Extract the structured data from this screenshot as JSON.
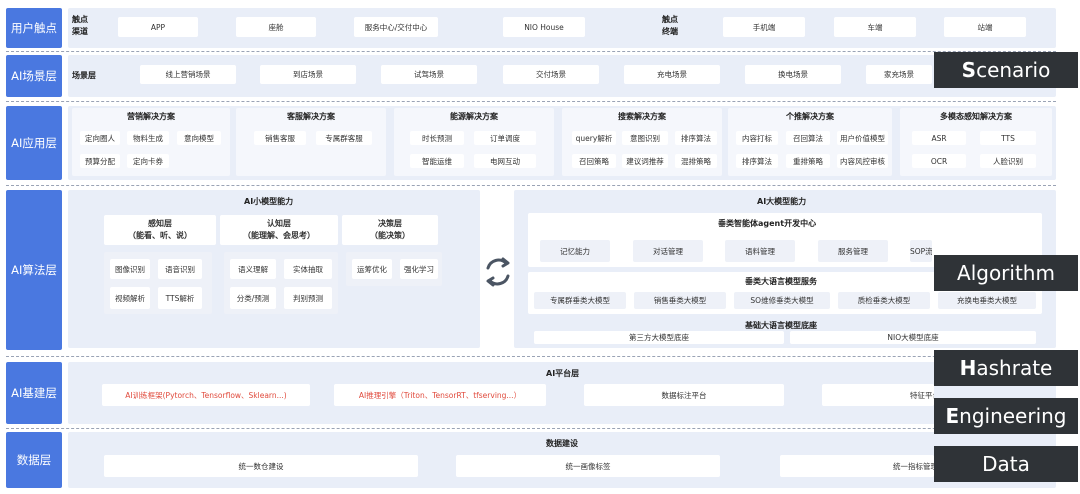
{
  "lanes": {
    "touch": "用户触点",
    "scene": "AI场景层",
    "app": "AI应用层",
    "algo": "AI算法层",
    "infra": "AI基建层",
    "data": "数据层"
  },
  "touch": {
    "channel_label": "触点\n渠道",
    "terminal_label": "触点\n终端",
    "channels": [
      "APP",
      "座舱",
      "服务中心/交付中心",
      "NIO House"
    ],
    "terminals": [
      "手机端",
      "车端",
      "站端"
    ]
  },
  "scene": {
    "label": "场景层",
    "items": [
      "线上营销场景",
      "到店场景",
      "试驾场景",
      "交付场景",
      "充电场景",
      "换电场景",
      "家充场景"
    ]
  },
  "apps": [
    {
      "title": "营销解决方案",
      "items": [
        "定向圈人",
        "物料生成",
        "意向模型",
        "预算分配",
        "定向卡券"
      ]
    },
    {
      "title": "客服解决方案",
      "items": [
        "销售客服",
        "专属群客服"
      ]
    },
    {
      "title": "能源解决方案",
      "items": [
        "时长预测",
        "订单调度",
        "智能运维",
        "电网互动"
      ]
    },
    {
      "title": "搜索解决方案",
      "items": [
        "query解析",
        "意图识别",
        "排序算法",
        "召回策略",
        "建议词推荐",
        "混排策略"
      ]
    },
    {
      "title": "个推解决方案",
      "items": [
        "内容打标",
        "召回算法",
        "用户价值模型",
        "排序算法",
        "重排策略",
        "内容风控审核"
      ]
    },
    {
      "title": "多模态感知解决方案",
      "items": [
        "ASR",
        "TTS",
        "OCR",
        "人脸识别"
      ]
    }
  ],
  "small_model": {
    "title": "AI小模型能力",
    "perceive": {
      "title": "感知层\n（能看、听、说）",
      "items": [
        "图像识别",
        "语音识别",
        "视频解析",
        "TTS解析"
      ]
    },
    "cognize": {
      "title": "认知层\n（能理解、会思考）",
      "items": [
        "语义理解",
        "实体抽取",
        "分类/预测",
        "判别预测"
      ]
    },
    "decide": {
      "title": "决策层\n（能决策）",
      "items": [
        "运筹优化",
        "强化学习"
      ]
    }
  },
  "large_model": {
    "title": "AI大模型能力",
    "agent_title": "垂类智能体agent开发中心",
    "agent_items": [
      "记忆能力",
      "对话管理",
      "语料管理",
      "服务管理",
      "SOP流程管理"
    ],
    "vertical_title": "垂类大语言模型服务",
    "vertical_items": [
      "专属群垂类大模型",
      "销售垂类大模型",
      "SO维修垂类大模型",
      "质检垂类大模型",
      "充换电垂类大模型"
    ],
    "base_title": "基础大语言模型底座",
    "base_items": [
      "第三方大模型底座",
      "NIO大模型底座"
    ]
  },
  "infra": {
    "title": "AI平台层",
    "items": [
      "AI训练框架(Pytorch、Tensorflow、Sklearn...)",
      "AI推理引擎（Triton、TensorRT、tfserving...）",
      "数据标注平台",
      "特征平台"
    ]
  },
  "data": {
    "title": "数据建设",
    "items": [
      "统一数仓建设",
      "统一画像标签",
      "统一指标管理"
    ]
  },
  "tags": [
    {
      "first": "S",
      "rest": "cenario"
    },
    {
      "first": "",
      "rest": "Algorithm"
    },
    {
      "first": "H",
      "rest": "ashrate"
    },
    {
      "first": "E",
      "rest": "ngineering"
    },
    {
      "first": "",
      "rest": "Data"
    }
  ],
  "colors": {
    "lane": "#4a78e0",
    "band": "#e9eef8",
    "tag": "#2f3337",
    "accent_red": "#e04a3c"
  },
  "icons": {
    "cycle": "refresh-cycle-icon"
  }
}
